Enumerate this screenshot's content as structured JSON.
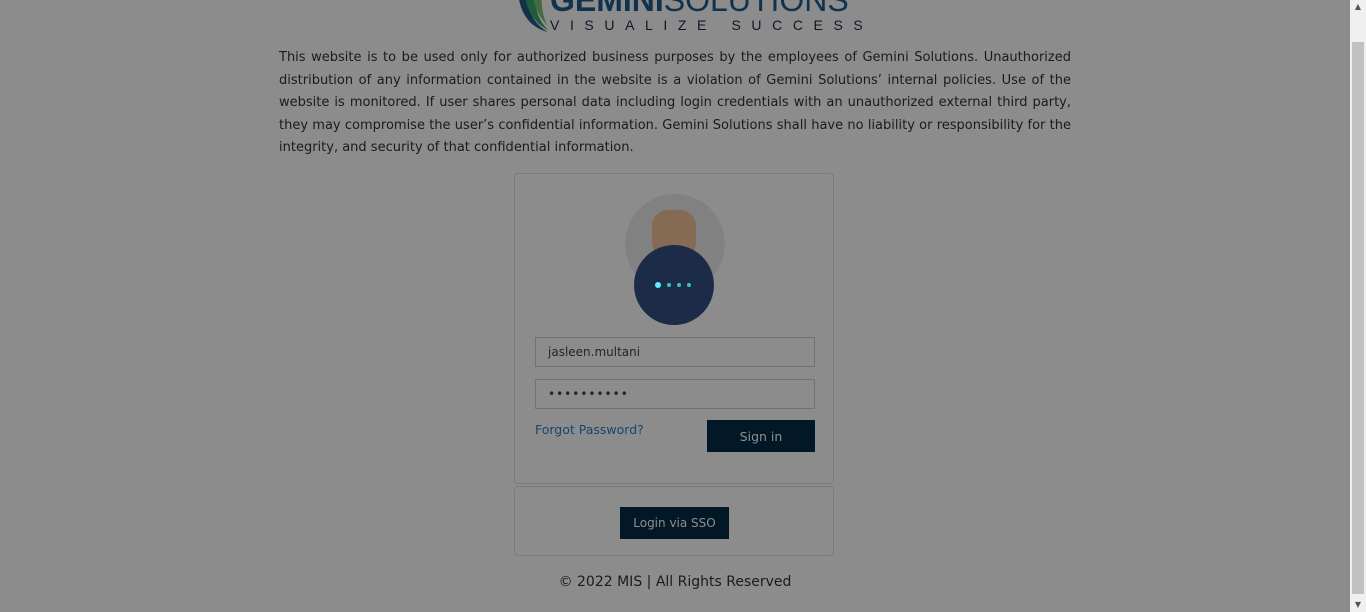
{
  "brand": {
    "name_bold": "GEMINI",
    "name_light": "SOLUTIONS",
    "tagline": "VISUALIZE SUCCESS",
    "colors": {
      "blue": "#1e5c8a",
      "navy": "#1b2a4a",
      "green": "#3aa86b"
    }
  },
  "disclaimer": "This website is to be used only for authorized business purposes by the employees of Gemini Solutions. Unauthorized distribution of any information contained in the website is a violation of Gemini Solutions’ internal policies. Use of the website is monitored. If user shares personal data including login credentials with an unauthorized external third party, they may compromise the user’s confidential information. Gemini Solutions shall have no liability or responsibility for the integrity, and security of that confidential information.",
  "login": {
    "avatar_icon": "user-avatar-icon",
    "username_value": "jasleen.multani",
    "password_value": "••••••••••",
    "forgot_label": "Forgot Password?",
    "signin_label": "Sign in",
    "button_color": "#062c45",
    "link_color": "#2f7fc8"
  },
  "sso": {
    "button_label": "Login via SSO"
  },
  "footer": "© 2022 MIS | All Rights Reserved",
  "overlay": {
    "spinner_icon": "loading-dots-icon",
    "color": "#1c2b47"
  }
}
